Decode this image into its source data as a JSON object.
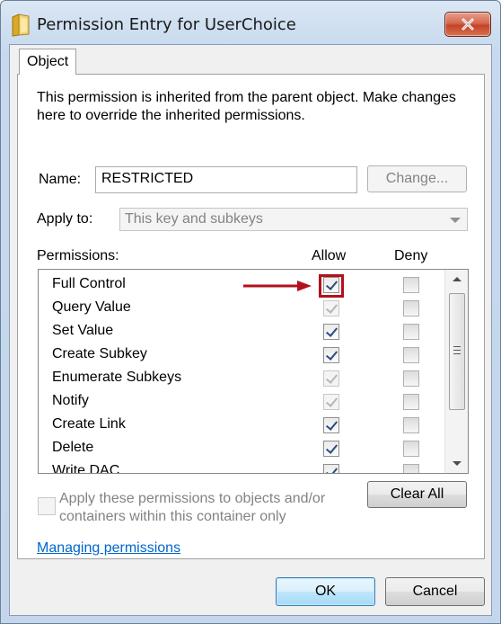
{
  "window": {
    "title": "Permission Entry for UserChoice",
    "icon": "folder-icon",
    "close_icon": "close-icon"
  },
  "tabs": [
    {
      "label": "Object"
    }
  ],
  "intro_text": "This permission is inherited from the parent object. Make changes here to override the inherited permissions.",
  "name": {
    "label": "Name:",
    "value": "RESTRICTED",
    "change_button": "Change..."
  },
  "apply_to": {
    "label": "Apply to:",
    "selected": "This key and subkeys"
  },
  "permissions": {
    "header": "Permissions:",
    "allow_header": "Allow",
    "deny_header": "Deny",
    "rows": [
      {
        "name": "Full Control",
        "allow": "checked",
        "deny": "unchecked"
      },
      {
        "name": "Query Value",
        "allow": "checked-inherited",
        "deny": "unchecked"
      },
      {
        "name": "Set Value",
        "allow": "checked",
        "deny": "unchecked"
      },
      {
        "name": "Create Subkey",
        "allow": "checked",
        "deny": "unchecked"
      },
      {
        "name": "Enumerate Subkeys",
        "allow": "checked-inherited",
        "deny": "unchecked"
      },
      {
        "name": "Notify",
        "allow": "checked-inherited",
        "deny": "unchecked"
      },
      {
        "name": "Create Link",
        "allow": "checked",
        "deny": "unchecked"
      },
      {
        "name": "Delete",
        "allow": "checked",
        "deny": "unchecked"
      },
      {
        "name": "Write DAC",
        "allow": "checked",
        "deny": "unchecked"
      }
    ]
  },
  "apply_checkbox": {
    "label": "Apply these permissions to objects and/or containers within this container only",
    "checked": false
  },
  "clear_all_button": "Clear All",
  "managing_link": "Managing permissions",
  "ok_button": "OK",
  "cancel_button": "Cancel",
  "colors": {
    "highlight": "#b3101b",
    "link": "#0066cc"
  }
}
